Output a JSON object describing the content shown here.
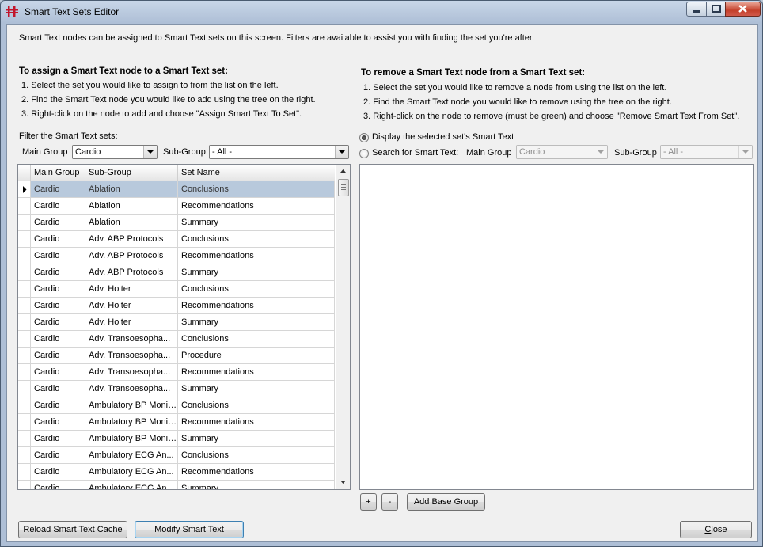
{
  "window": {
    "title": "Smart Text Sets Editor"
  },
  "intro": "Smart Text nodes can be assigned to Smart Text sets on this screen.  Filters are available to assist you with finding the set you're after.",
  "assign": {
    "heading": "To assign a Smart Text node to a Smart Text set:",
    "steps": [
      "1. Select the set you would like to assign to from the list on the left.",
      "2. Find the Smart Text node you would like to add using the tree on the right.",
      "3. Right-click on the node to add and choose \"Assign Smart Text To Set\"."
    ]
  },
  "remove": {
    "heading": "To remove a Smart Text node from a Smart Text set:",
    "steps": [
      "1. Select the set you would like to remove a node from using the list on the left.",
      "2. Find the Smart Text node you would like to remove using the tree on the right.",
      "3. Right-click on the node to remove (must be green) and choose \"Remove Smart Text From Set\"."
    ]
  },
  "filter": {
    "label": "Filter the Smart Text sets:",
    "main_group_label": "Main Group",
    "main_group_value": "Cardio",
    "sub_group_label": "Sub-Group",
    "sub_group_value": "- All -"
  },
  "grid": {
    "columns": [
      "Main Group",
      "Sub-Group",
      "Set Name"
    ],
    "rows": [
      [
        "Cardio",
        "Ablation",
        "Conclusions"
      ],
      [
        "Cardio",
        "Ablation",
        "Recommendations"
      ],
      [
        "Cardio",
        "Ablation",
        "Summary"
      ],
      [
        "Cardio",
        "Adv. ABP Protocols",
        "Conclusions"
      ],
      [
        "Cardio",
        "Adv. ABP Protocols",
        "Recommendations"
      ],
      [
        "Cardio",
        "Adv. ABP Protocols",
        "Summary"
      ],
      [
        "Cardio",
        "Adv. Holter",
        "Conclusions"
      ],
      [
        "Cardio",
        "Adv. Holter",
        "Recommendations"
      ],
      [
        "Cardio",
        "Adv. Holter",
        "Summary"
      ],
      [
        "Cardio",
        "Adv. Transoesopha...",
        "Conclusions"
      ],
      [
        "Cardio",
        "Adv. Transoesopha...",
        "Procedure"
      ],
      [
        "Cardio",
        "Adv. Transoesopha...",
        "Recommendations"
      ],
      [
        "Cardio",
        "Adv. Transoesopha...",
        "Summary"
      ],
      [
        "Cardio",
        "Ambulatory BP Monit...",
        "Conclusions"
      ],
      [
        "Cardio",
        "Ambulatory BP Monit...",
        "Recommendations"
      ],
      [
        "Cardio",
        "Ambulatory BP Monit...",
        "Summary"
      ],
      [
        "Cardio",
        "Ambulatory ECG An...",
        "Conclusions"
      ],
      [
        "Cardio",
        "Ambulatory ECG An...",
        "Recommendations"
      ],
      [
        "Cardio",
        "Ambulatory ECG An...",
        "Summary"
      ]
    ]
  },
  "right": {
    "radio_display_label": "Display the selected set's Smart Text",
    "radio_search_label": "Search for Smart Text:",
    "main_group_label": "Main Group",
    "main_group_value": "Cardio",
    "sub_group_label": "Sub-Group",
    "sub_group_value": "- All -"
  },
  "buttons": {
    "plus": "+",
    "minus": "-",
    "add_base_group": "Add Base Group",
    "reload_cache": "Reload Smart Text Cache",
    "modify_smart_text": "Modify Smart Text",
    "close_mnemonic": "C",
    "close_rest": "lose"
  }
}
